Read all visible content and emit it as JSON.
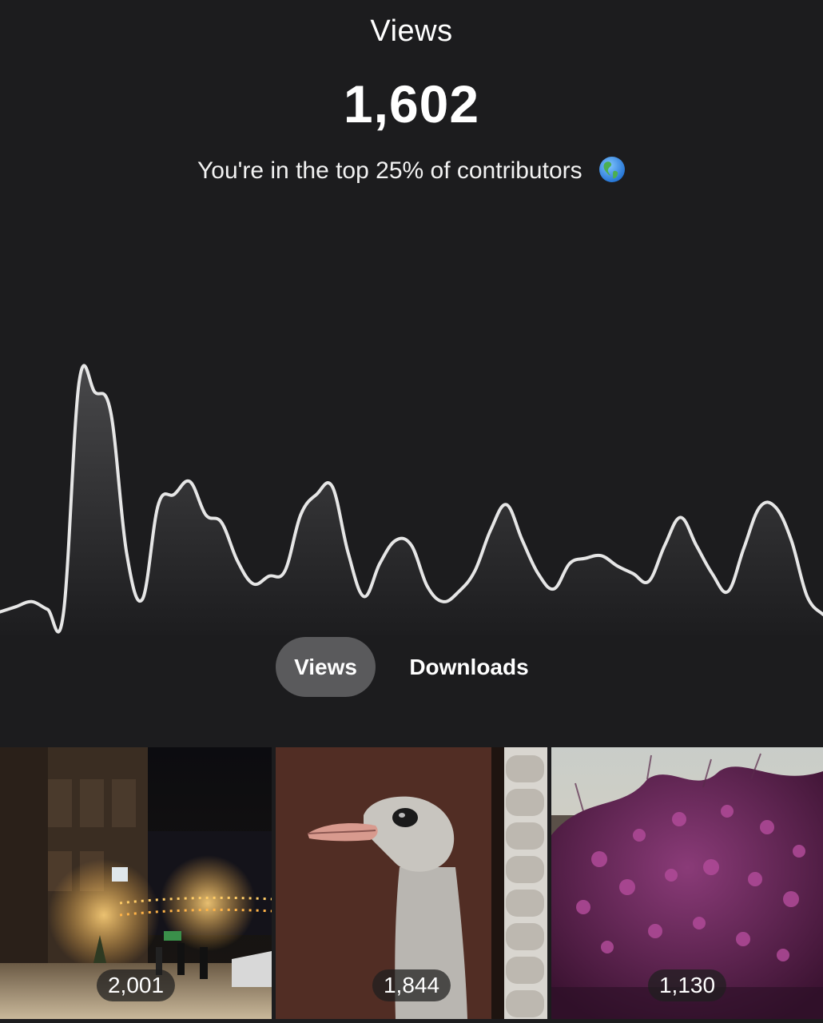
{
  "header": {
    "title": "Views",
    "total": "1,602",
    "rank_text": "You're in the top 25% of contributors",
    "rank_icon": "globe-americas-icon"
  },
  "chart_data": {
    "type": "area",
    "title": "",
    "xlabel": "",
    "ylabel": "",
    "grid": false,
    "axes_visible": false,
    "line_color": "#e6e6e6",
    "series": [
      {
        "values": [
          2,
          4,
          6,
          3,
          1,
          92,
          88,
          80,
          25,
          7,
          44,
          48,
          53,
          40,
          37,
          22,
          13,
          16,
          18,
          40,
          48,
          51,
          25,
          8,
          21,
          30,
          28,
          12,
          6,
          10,
          18,
          34,
          44,
          30,
          17,
          11,
          21,
          23,
          24,
          20,
          17,
          14,
          28,
          39,
          28,
          17,
          10,
          27,
          43,
          43,
          30,
          8,
          1
        ]
      }
    ]
  },
  "tabs": [
    {
      "label": "Views",
      "active": true
    },
    {
      "label": "Downloads",
      "active": false
    }
  ],
  "photos": [
    {
      "count": "2,001"
    },
    {
      "count": "1,844"
    },
    {
      "count": "1,130"
    }
  ],
  "colors": {
    "background": "#1c1c1e",
    "active_tab": "#5a5a5c",
    "text": "#ffffff"
  }
}
